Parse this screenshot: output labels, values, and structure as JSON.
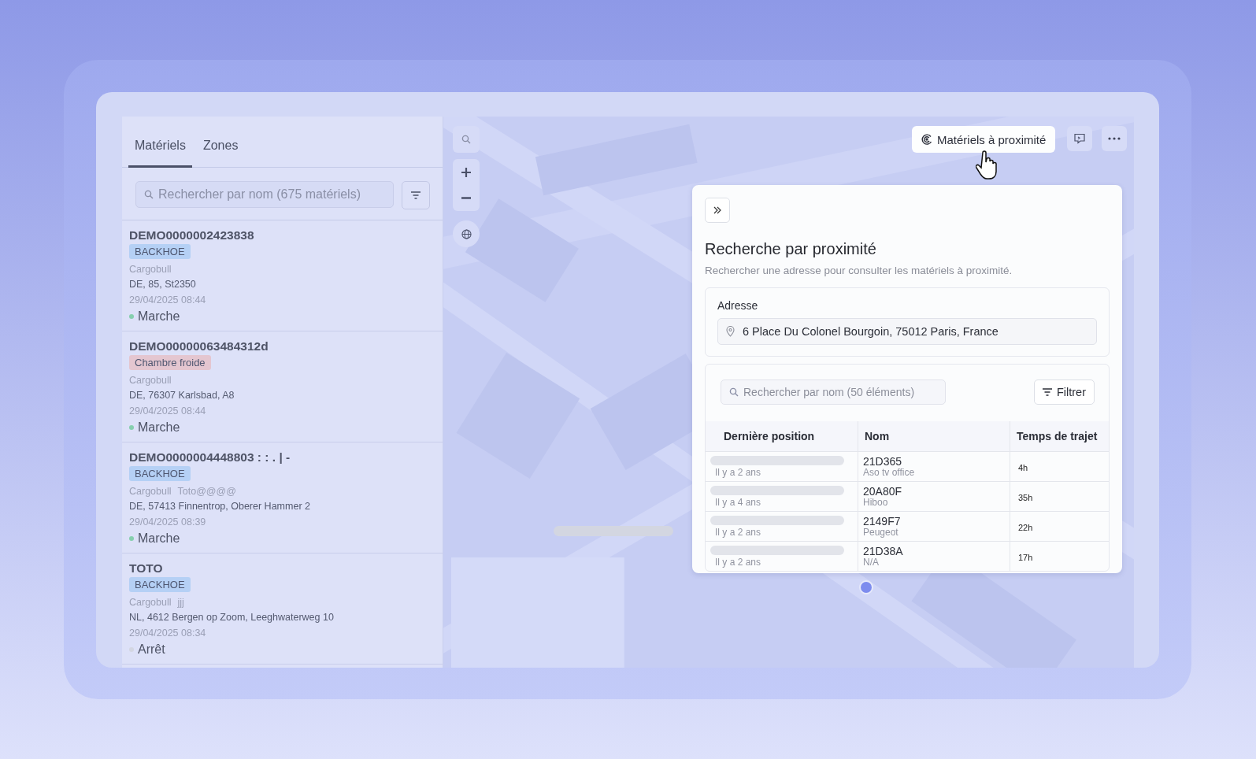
{
  "sidebar": {
    "tabs": [
      {
        "label": "Matériels",
        "selected": true
      },
      {
        "label": "Zones",
        "selected": false
      }
    ],
    "search": {
      "placeholder": "Rechercher par nom (675 matériels)"
    },
    "items": [
      {
        "name": "DEMO0000002423838",
        "tag": {
          "label": "BACKHOE",
          "color": "#b5d0f5"
        },
        "brand": "Cargobull",
        "address": "DE, 85, St2350",
        "date": "29/04/2025 08:44",
        "status": {
          "label": "Marche",
          "color": "#86cfae"
        }
      },
      {
        "name": "DEMO00000063484312d",
        "tag": {
          "label": "Chambre froide",
          "color": "#e4c6d0"
        },
        "brand": "Cargobull",
        "address": "DE, 76307 Karlsbad, A8",
        "date": "29/04/2025 08:44",
        "status": {
          "label": "Marche",
          "color": "#86cfae"
        }
      },
      {
        "name": "DEMO0000004448803 : : . | -",
        "tag": {
          "label": "BACKHOE",
          "color": "#b5d0f5"
        },
        "brand": "Cargobull",
        "owner": "Toto@@@@",
        "address": "DE, 57413 Finnentrop, Oberer Hammer 2",
        "date": "29/04/2025 08:39",
        "status": {
          "label": "Marche",
          "color": "#86cfae"
        }
      },
      {
        "name": "TOTO",
        "tag": {
          "label": "BACKHOE",
          "color": "#b5d0f5"
        },
        "brand": "Cargobull",
        "owner": "jjj",
        "address": "NL, 4612 Bergen op Zoom, Leeghwaterweg 10",
        "date": "29/04/2025 08:34",
        "status": {
          "label": "Arrêt",
          "color": "#d3d6e2"
        }
      }
    ]
  },
  "map": {
    "nearby_button": {
      "label": "Matériels à proximité"
    },
    "panel": {
      "title": "Recherche par proximité",
      "subtitle": "Rechercher une adresse pour consulter les matériels à proximité.",
      "address": {
        "label": "Adresse",
        "value": "6 Place Du Colonel Bourgoin, 75012 Paris, France"
      },
      "search": {
        "placeholder": "Rechercher par nom (50 éléments)"
      },
      "filter_button": "Filtrer",
      "columns": [
        "Dernière position",
        "Nom",
        "Temps de trajet"
      ],
      "rows": [
        {
          "position": "Il y a 2 ans",
          "name": "21D365",
          "detail": "Aso tv office",
          "travel_time": "4h"
        },
        {
          "position": "Il y a 4 ans",
          "name": "20A80F",
          "detail": "Hiboo",
          "travel_time": "35h"
        },
        {
          "position": "Il y a 2 ans",
          "name": "2149F7",
          "detail": "Peugeot",
          "travel_time": "22h"
        },
        {
          "position": "Il y a 2 ans",
          "name": "21D38A",
          "detail": "N/A",
          "travel_time": "17h"
        }
      ]
    }
  }
}
